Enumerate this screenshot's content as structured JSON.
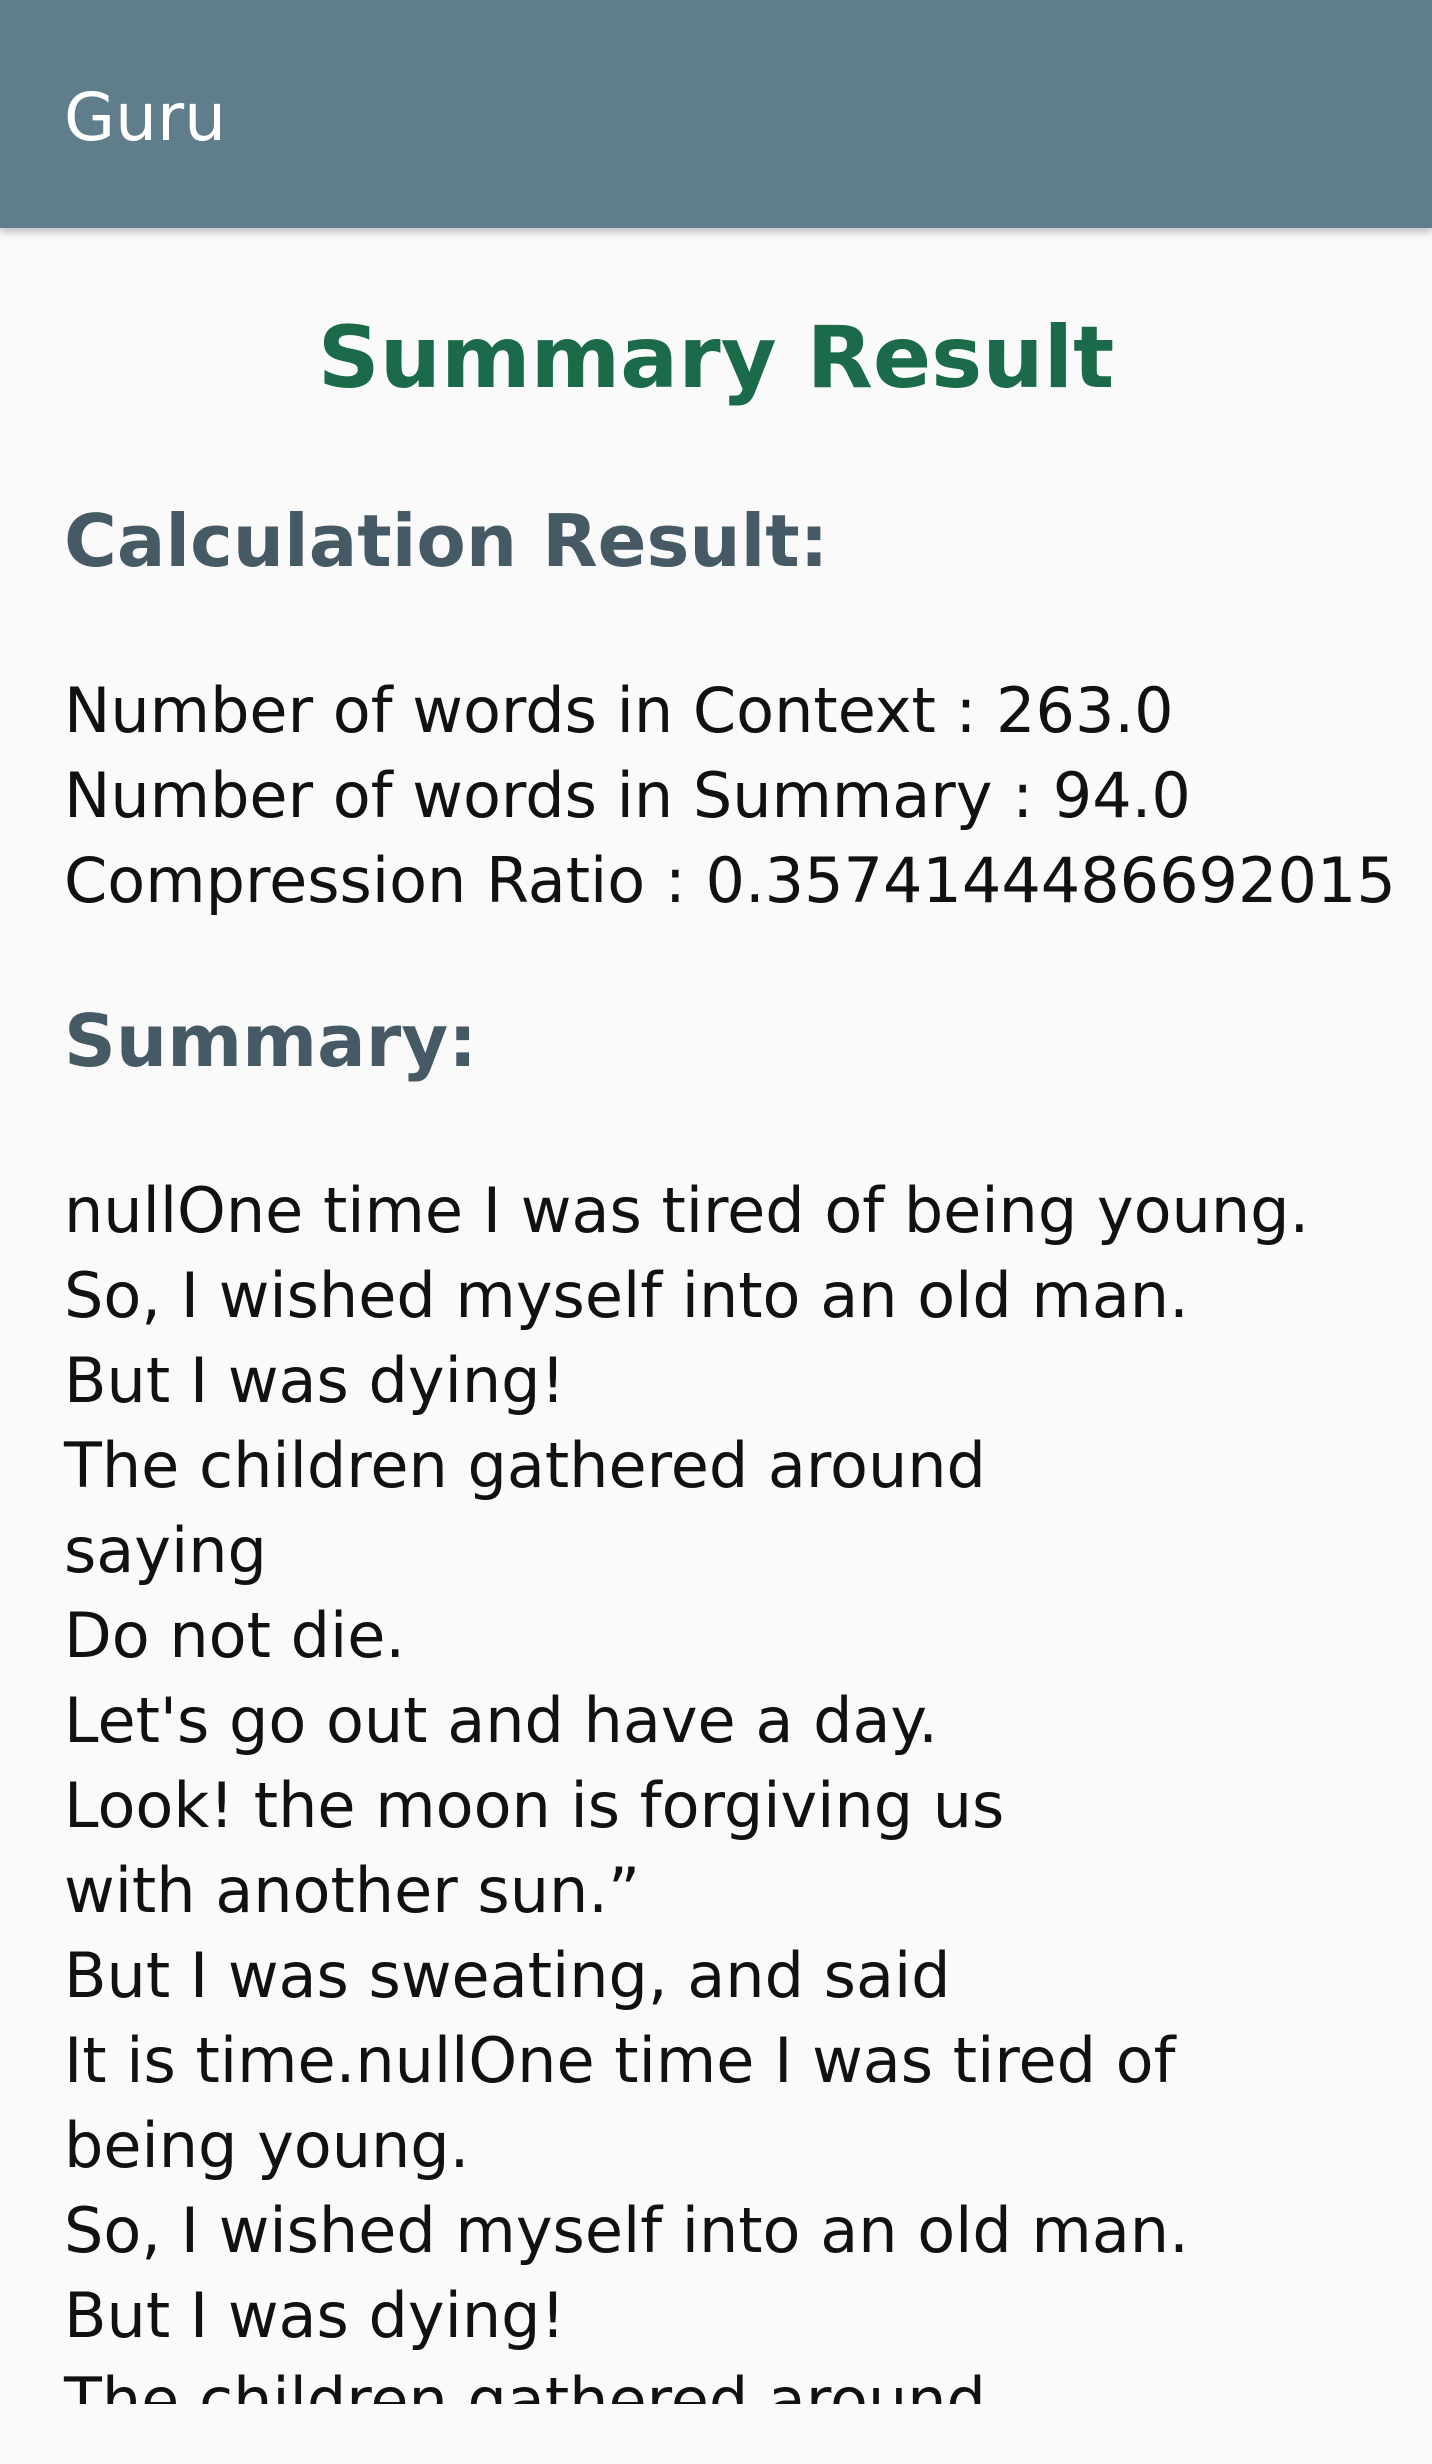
{
  "app_bar": {
    "title": "Guru"
  },
  "page": {
    "heading": "Summary Result"
  },
  "calculation": {
    "label": "Calculation Result:",
    "context_words": "Number of words in Context : 263.0",
    "summary_words": "Number of words in Summary : 94.0",
    "compression_ratio": "Compression Ratio : 0.3574144486692015"
  },
  "summary": {
    "label": "Summary:",
    "text": "nullOne time I was tired of being young.\nSo, I wished myself into an old man.\nBut I was dying!\nThe children gathered around\nsaying\nDo not die.\nLet's go out and have a day.\nLook! the moon is forgiving us\nwith another sun.”\nBut I was sweating, and said\nIt is time.nullOne time I was tired of being young.\nSo, I wished myself into an old man.\nBut I was dying!\nThe children gathered around"
  },
  "colors": {
    "app_bar": "#607d8b",
    "heading": "#1b6b4a",
    "section_label": "#455a64",
    "background": "#fafafa"
  }
}
